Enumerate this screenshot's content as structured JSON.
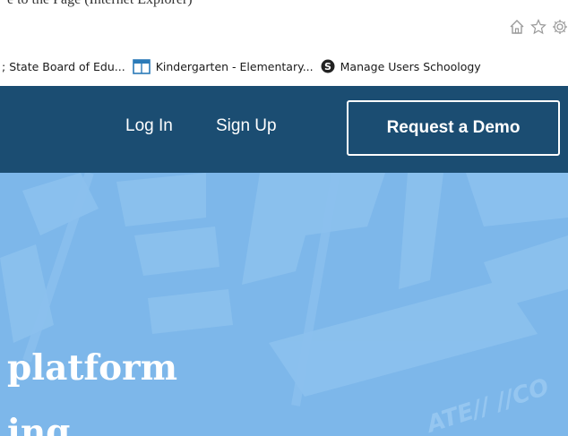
{
  "top_fragment": {
    "text": "e to the Page (Internet Explorer)",
    "underscore": "_"
  },
  "chrome": {
    "icons": [
      "home-icon",
      "star-icon",
      "gear-icon"
    ]
  },
  "favorites": [
    {
      "label": "State Board of Edu...",
      "icon": "none",
      "prefix": ";"
    },
    {
      "label": "Kindergarten - Elementary...",
      "icon": "page-icon"
    },
    {
      "label": "Manage Users Schoology",
      "icon": "schoology-icon"
    }
  ],
  "header": {
    "login_label": "Log In",
    "signup_label": "Sign Up",
    "demo_label": "Request a Demo",
    "bg_color": "#1b4d72"
  },
  "hero": {
    "bg_color": "#7db7ea",
    "heading": "platform",
    "heading_line2": "ing",
    "watermark_text": "ATE// //CO"
  }
}
